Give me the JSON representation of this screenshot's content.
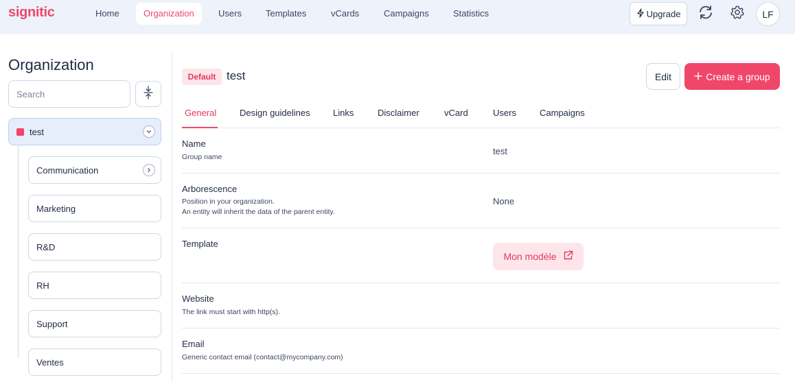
{
  "brand": {
    "logo_text": "signitic",
    "accent": "#f0466a"
  },
  "nav": {
    "items": [
      {
        "label": "Home",
        "active": false
      },
      {
        "label": "Organization",
        "active": true
      },
      {
        "label": "Users",
        "active": false
      },
      {
        "label": "Templates",
        "active": false
      },
      {
        "label": "vCards",
        "active": false
      },
      {
        "label": "Campaigns",
        "active": false
      },
      {
        "label": "Statistics",
        "active": false
      }
    ],
    "upgrade_label": "Upgrade",
    "upgrade_icon": "lightning-icon",
    "sync_icon": "sync-icon",
    "settings_icon": "gear-icon",
    "avatar_initials": "LF"
  },
  "sidebar": {
    "title": "Organization",
    "search_placeholder": "Search",
    "collapse_icon": "collapse-icon",
    "root": {
      "label": "test",
      "color": "#f0466a",
      "expanded": true
    },
    "children": [
      {
        "label": "Communication",
        "has_children": true
      },
      {
        "label": "Marketing",
        "has_children": false
      },
      {
        "label": "R&D",
        "has_children": false
      },
      {
        "label": "RH",
        "has_children": false
      },
      {
        "label": "Support",
        "has_children": false
      },
      {
        "label": "Ventes",
        "has_children": false
      }
    ]
  },
  "main": {
    "badge": "Default",
    "title": "test",
    "edit_label": "Edit",
    "create_label": "Create a group",
    "tabs": [
      {
        "label": "General",
        "active": true
      },
      {
        "label": "Design guidelines",
        "active": false
      },
      {
        "label": "Links",
        "active": false
      },
      {
        "label": "Disclaimer",
        "active": false
      },
      {
        "label": "vCard",
        "active": false
      },
      {
        "label": "Users",
        "active": false
      },
      {
        "label": "Campaigns",
        "active": false
      }
    ],
    "fields": {
      "name": {
        "label": "Name",
        "desc": "Group name",
        "value": "test"
      },
      "arborescence": {
        "label": "Arborescence",
        "desc1": "Position in your organization.",
        "desc2": "An entity will inherit the data of the parent entity.",
        "value": "None"
      },
      "template": {
        "label": "Template",
        "button_label": "Mon modèle"
      },
      "website": {
        "label": "Website",
        "desc": "The link must start with http(s)."
      },
      "email": {
        "label": "Email",
        "desc": "Generic contact email (contact@mycompany.com)"
      }
    }
  }
}
